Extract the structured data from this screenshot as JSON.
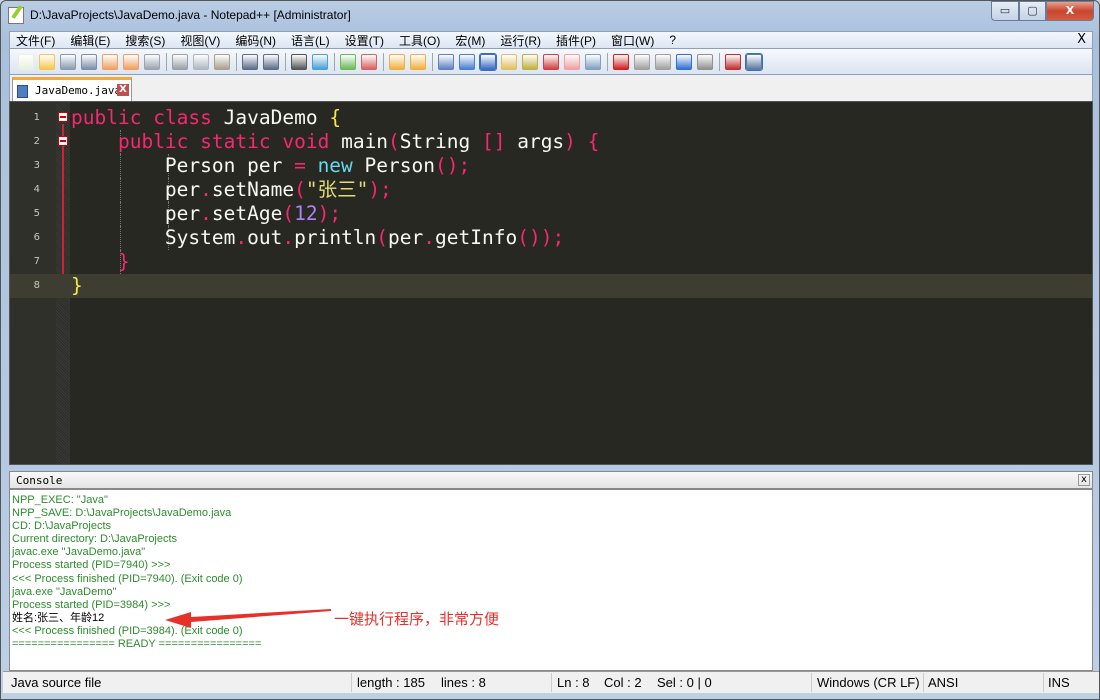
{
  "window": {
    "title": "D:\\JavaProjects\\JavaDemo.java - Notepad++ [Administrator]",
    "minimize": "▭",
    "maximize": "▢",
    "close": "X"
  },
  "menu": {
    "items": [
      "文件(F)",
      "编辑(E)",
      "搜索(S)",
      "视图(V)",
      "编码(N)",
      "语言(L)",
      "设置(T)",
      "工具(O)",
      "宏(M)",
      "运行(R)",
      "插件(P)",
      "窗口(W)",
      "?"
    ],
    "close": "X"
  },
  "toolbar": {
    "groups": [
      [
        [
          "new-file-icon",
          "#e8f0e0"
        ],
        [
          "open-file-icon",
          "#f2c94c"
        ],
        [
          "save-icon",
          "#8a9bb0"
        ],
        [
          "save-all-icon",
          "#7d8fa5"
        ],
        [
          "close-file-icon",
          "#f0a060"
        ],
        [
          "close-all-icon",
          "#f0a060"
        ],
        [
          "print-icon",
          "#9aa4b0"
        ]
      ],
      [
        [
          "cut-icon",
          "#9aa0a8"
        ],
        [
          "copy-icon",
          "#b0b6c0"
        ],
        [
          "paste-icon",
          "#a8a090"
        ]
      ],
      [
        [
          "undo-icon",
          "#5a6e8a"
        ],
        [
          "redo-icon",
          "#5a6e8a"
        ]
      ],
      [
        [
          "find-icon",
          "#555"
        ],
        [
          "replace-icon",
          "#4aa0d8"
        ]
      ],
      [
        [
          "zoom-in-icon",
          "#6cba5a"
        ],
        [
          "zoom-out-icon",
          "#d86060"
        ]
      ],
      [
        [
          "sync-vertical-icon",
          "#f0b040"
        ],
        [
          "sync-horizontal-icon",
          "#f0b040"
        ]
      ],
      [
        [
          "word-wrap-icon",
          "#6080c0"
        ],
        [
          "show-all-chars-icon",
          "#4a80d0"
        ],
        [
          "indent-guide-icon",
          "#3a6fc0",
          "active"
        ],
        [
          "user-language-icon",
          "#e0c060"
        ],
        [
          "document-map-icon",
          "#c0b040"
        ],
        [
          "function-list-icon",
          "#d04040"
        ],
        [
          "folder-workspace-icon",
          "#f0a0a0"
        ],
        [
          "monitoring-icon",
          "#80a0c0"
        ]
      ],
      [
        [
          "record-macro-icon",
          "#d02020"
        ],
        [
          "stop-record-icon",
          "#a0a0a0"
        ],
        [
          "play-macro-icon",
          "#a0a0a0"
        ],
        [
          "run-macro-multiple-icon",
          "#3070d0"
        ],
        [
          "save-macro-icon",
          "#909090"
        ]
      ],
      [
        [
          "spell-check-icon",
          "#c03030"
        ],
        [
          "console-icon",
          "#5a7aa0",
          "active"
        ]
      ]
    ]
  },
  "tab": {
    "label": "JavaDemo.java",
    "close": "X"
  },
  "editor": {
    "current_line": 8,
    "lines": [
      [
        [
          "public",
          "k"
        ],
        [
          " "
        ],
        [
          "class",
          "k"
        ],
        [
          " JavaDemo "
        ],
        [
          "{",
          "b"
        ]
      ],
      [
        [
          "    "
        ],
        [
          "public",
          "k"
        ],
        [
          " "
        ],
        [
          "static",
          "k"
        ],
        [
          " "
        ],
        [
          "void",
          "k"
        ],
        [
          " main"
        ],
        [
          "(",
          "p"
        ],
        [
          "String "
        ],
        [
          "[]",
          "p"
        ],
        [
          " args"
        ],
        [
          ")",
          "p"
        ],
        [
          " "
        ],
        [
          "{",
          "p"
        ]
      ],
      [
        [
          "        Person per "
        ],
        [
          "=",
          "p"
        ],
        [
          " "
        ],
        [
          "new",
          "c"
        ],
        [
          " Person"
        ],
        [
          "();",
          "p"
        ]
      ],
      [
        [
          "        per"
        ],
        [
          ".",
          "p"
        ],
        [
          "setName"
        ],
        [
          "(",
          "p"
        ],
        [
          "\"张三\"",
          "s"
        ],
        [
          ");",
          "p"
        ]
      ],
      [
        [
          "        per"
        ],
        [
          ".",
          "p"
        ],
        [
          "setAge"
        ],
        [
          "(",
          "p"
        ],
        [
          "12",
          "n"
        ],
        [
          ");",
          "p"
        ]
      ],
      [
        [
          "        System"
        ],
        [
          ".",
          "p"
        ],
        [
          "out"
        ],
        [
          ".",
          "p"
        ],
        [
          "println"
        ],
        [
          "(",
          "p"
        ],
        [
          "per"
        ],
        [
          ".",
          "p"
        ],
        [
          "getInfo"
        ],
        [
          "());",
          "p"
        ]
      ],
      [
        [
          "    "
        ],
        [
          "}",
          "p"
        ]
      ],
      [
        [
          "}",
          "b"
        ]
      ]
    ]
  },
  "console": {
    "title": "Console",
    "close": "x",
    "lines": [
      {
        "text": "NPP_EXEC: \"Java\""
      },
      {
        "text": "NPP_SAVE: D:\\JavaProjects\\JavaDemo.java"
      },
      {
        "text": "CD: D:\\JavaProjects"
      },
      {
        "text": "Current directory: D:\\JavaProjects"
      },
      {
        "text": "javac.exe \"JavaDemo.java\""
      },
      {
        "text": "Process started (PID=7940) >>>"
      },
      {
        "text": "<<< Process finished (PID=7940). (Exit code 0)"
      },
      {
        "text": "java.exe \"JavaDemo\""
      },
      {
        "text": "Process started (PID=3984) >>>"
      },
      {
        "text": "姓名:张三、年龄12",
        "output": true
      },
      {
        "text": "<<< Process finished (PID=3984). (Exit code 0)"
      },
      {
        "text": "================ READY ================"
      }
    ]
  },
  "annotation": {
    "text": "一键执行程序，非常方便",
    "color": "#e8302a"
  },
  "status": {
    "file_type": "Java source file",
    "length": "length : 185",
    "lines": "lines : 8",
    "ln": "Ln : 8",
    "col": "Col : 2",
    "sel": "Sel : 0 | 0",
    "eol": "Windows (CR LF)",
    "encoding": "ANSI",
    "mode": "INS"
  }
}
